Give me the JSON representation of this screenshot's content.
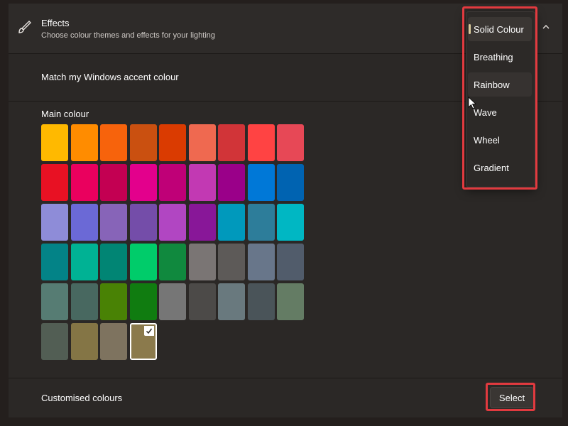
{
  "header": {
    "title": "Effects",
    "subtitle": "Choose colour themes and effects for your lighting",
    "icon": "brush-icon"
  },
  "accent_row": {
    "label": "Match my Windows accent colour"
  },
  "main_colour": {
    "label": "Main colour",
    "swatches": [
      "#ffb900",
      "#ff8c00",
      "#f7630c",
      "#ca5010",
      "#da3b01",
      "#ef6950",
      "#d13438",
      "#ff4343",
      "#e74856",
      "#e81123",
      "#ea005e",
      "#c30052",
      "#e3008c",
      "#bf0077",
      "#c239b3",
      "#9a0089",
      "#0078d7",
      "#0063b1",
      "#8e8cd8",
      "#6b69d6",
      "#8764b8",
      "#744da9",
      "#b146c2",
      "#881798",
      "#0099bc",
      "#2d7d9a",
      "#00b7c3",
      "#038387",
      "#00b294",
      "#018574",
      "#00cc6a",
      "#10893e",
      "#7a7574",
      "#5d5a58",
      "#68768a",
      "#515c6b",
      "#567c73",
      "#486860",
      "#498205",
      "#107c10",
      "#767676",
      "#4c4a48",
      "#69797e",
      "#4a5459",
      "#647c64",
      "#525e54",
      "#847545",
      "#7e735f",
      "#8b7a4c"
    ],
    "selected_index": 48,
    "selected_icon": "checkmark-icon"
  },
  "custom_row": {
    "label": "Customised colours",
    "button_label": "Select"
  },
  "dropdown": {
    "items": [
      "Solid Colour",
      "Breathing",
      "Rainbow",
      "Wave",
      "Wheel",
      "Gradient"
    ],
    "selected_index": 0,
    "hover_index": 2
  },
  "colors": {
    "highlight": "#e23a3f",
    "selection_bar": "#d8c99a"
  }
}
